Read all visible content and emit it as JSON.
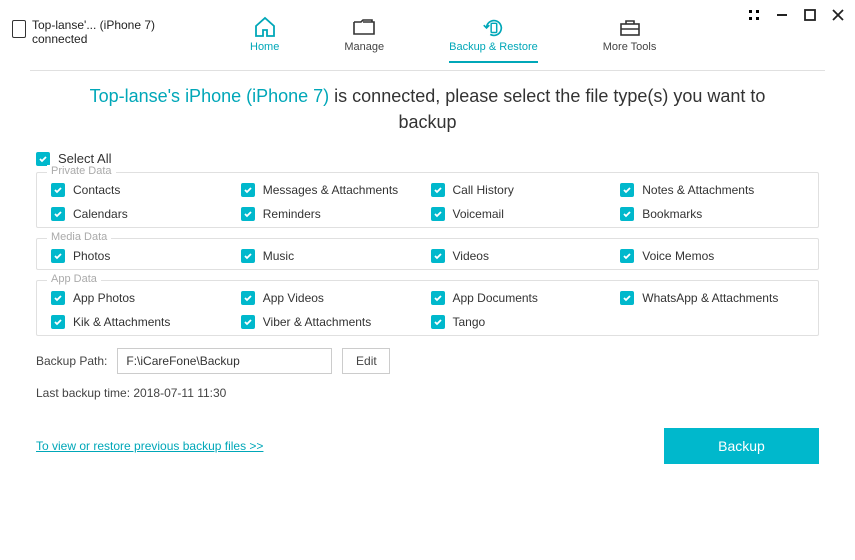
{
  "device": {
    "name": "Top-lanse'... (iPhone 7)",
    "status": "connected"
  },
  "nav": {
    "home": "Home",
    "manage": "Manage",
    "backup": "Backup & Restore",
    "tools": "More Tools"
  },
  "headline": {
    "device": "Top-lanse's iPhone (iPhone 7)",
    "rest": " is connected, please select the file type(s) you want to backup"
  },
  "select_all": "Select All",
  "groups": {
    "private": {
      "title": "Private Data",
      "items": [
        "Contacts",
        "Messages & Attachments",
        "Call History",
        "Notes & Attachments",
        "Calendars",
        "Reminders",
        "Voicemail",
        "Bookmarks"
      ]
    },
    "media": {
      "title": "Media Data",
      "items": [
        "Photos",
        "Music",
        "Videos",
        "Voice Memos"
      ]
    },
    "app": {
      "title": "App Data",
      "items": [
        "App Photos",
        "App Videos",
        "App Documents",
        "WhatsApp & Attachments",
        "Kik & Attachments",
        "Viber & Attachments",
        "Tango"
      ]
    }
  },
  "path": {
    "label": "Backup Path:",
    "value": "F:\\iCareFone\\Backup",
    "edit": "Edit"
  },
  "last_backup": "Last backup time: 2018-07-11 11:30",
  "prev_link": "To view or restore previous backup files >>",
  "backup_btn": "Backup"
}
